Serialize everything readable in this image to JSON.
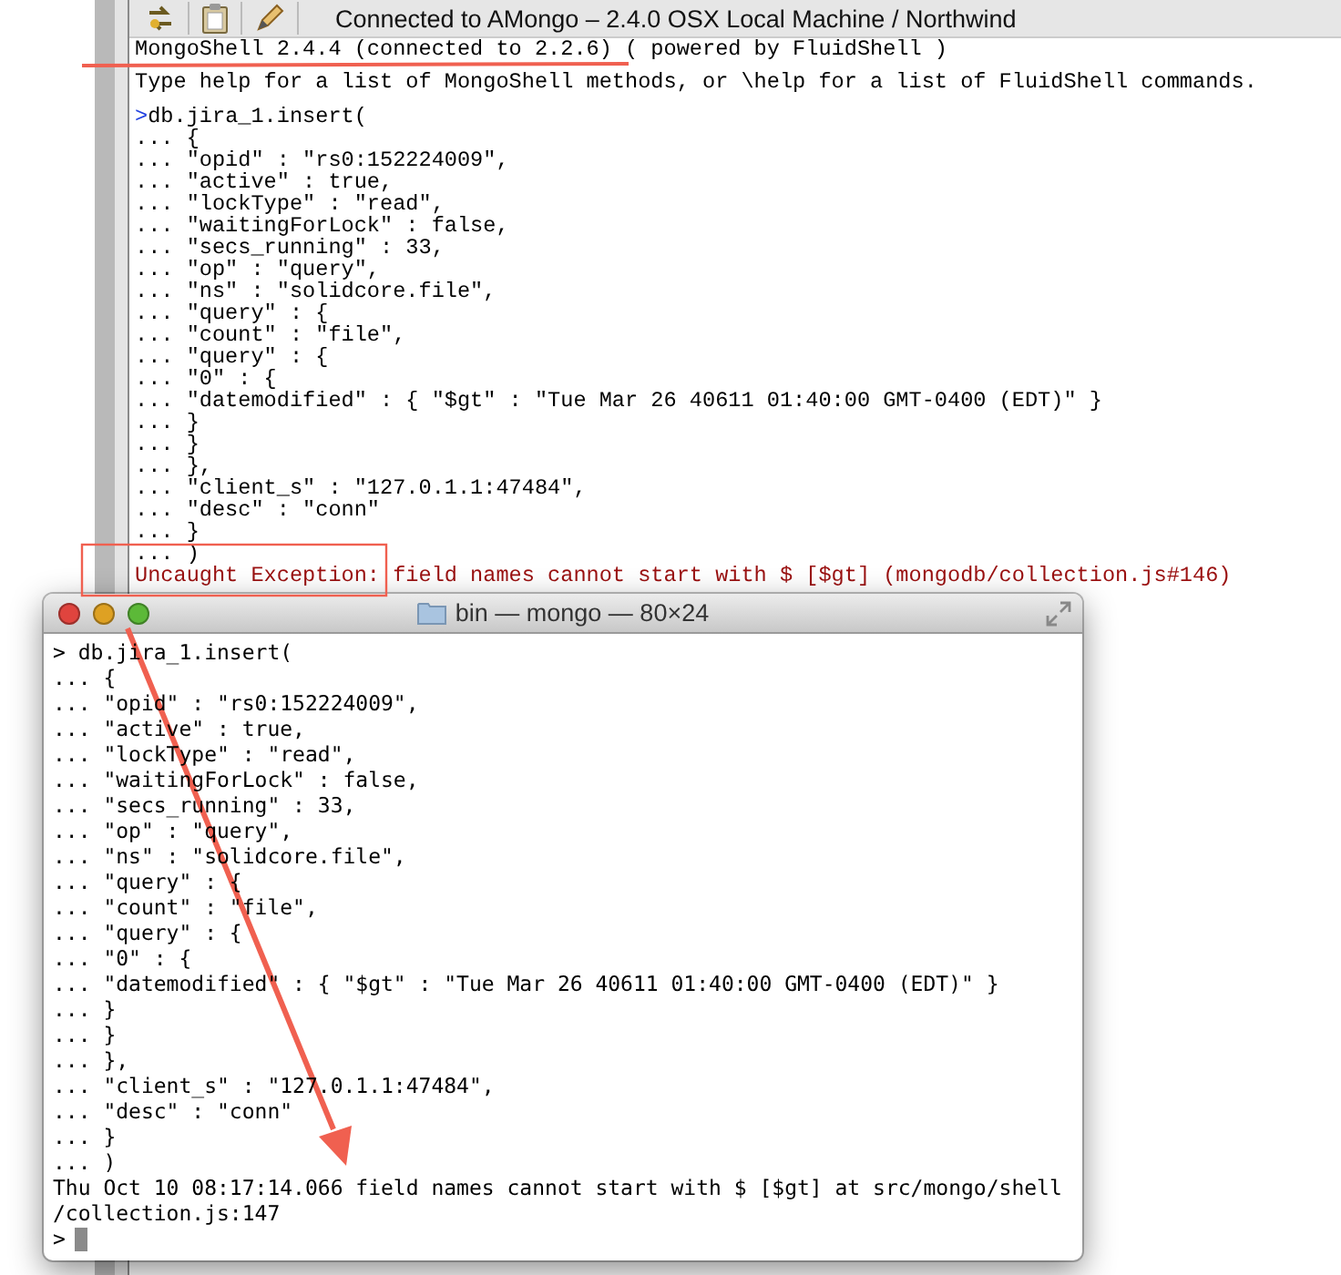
{
  "toolbar": {
    "title": "Connected to AMongo – 2.4.0 OSX Local Machine / Northwind"
  },
  "shell": {
    "lines": [
      {
        "kind": "output",
        "text": "MongoShell 2.4.4 (connected to 2.2.6) ( powered by FluidShell )"
      },
      {
        "kind": "output",
        "text": "Type help for a list of MongoShell methods, or \\help for a list of FluidShell commands."
      },
      {
        "kind": "input",
        "prompt": ">",
        "text": "db.jira_1.insert("
      },
      {
        "kind": "plain",
        "text": "... {"
      },
      {
        "kind": "plain",
        "text": "... \"opid\" : \"rs0:152224009\","
      },
      {
        "kind": "plain",
        "text": "... \"active\" : true,"
      },
      {
        "kind": "plain",
        "text": "... \"lockType\" : \"read\","
      },
      {
        "kind": "plain",
        "text": "... \"waitingForLock\" : false,"
      },
      {
        "kind": "plain",
        "text": "... \"secs_running\" : 33,"
      },
      {
        "kind": "plain",
        "text": "... \"op\" : \"query\","
      },
      {
        "kind": "plain",
        "text": "... \"ns\" : \"solidcore.file\","
      },
      {
        "kind": "plain",
        "text": "... \"query\" : {"
      },
      {
        "kind": "plain",
        "text": "... \"count\" : \"file\","
      },
      {
        "kind": "plain",
        "text": "... \"query\" : {"
      },
      {
        "kind": "plain",
        "text": "... \"0\" : {"
      },
      {
        "kind": "plain",
        "text": "... \"datemodified\" : { \"$gt\" : \"Tue Mar 26 40611 01:40:00 GMT-0400 (EDT)\" }"
      },
      {
        "kind": "plain",
        "text": "... }"
      },
      {
        "kind": "plain",
        "text": "... }"
      },
      {
        "kind": "plain",
        "text": "... },"
      },
      {
        "kind": "plain",
        "text": "... \"client_s\" : \"127.0.1.1:47484\","
      },
      {
        "kind": "plain",
        "text": "... \"desc\" : \"conn\""
      },
      {
        "kind": "plain",
        "text": "... }"
      },
      {
        "kind": "plain",
        "text": "... )"
      },
      {
        "kind": "error",
        "text": "Uncaught Exception: field names cannot start with $ [$gt] (mongodb/collection.js#146)"
      }
    ]
  },
  "terminal": {
    "title": "bin — mongo — 80×24",
    "cursor": true,
    "lines": [
      "> db.jira_1.insert(",
      "... {",
      "... \"opid\" : \"rs0:152224009\",",
      "... \"active\" : true,",
      "... \"lockType\" : \"read\",",
      "... \"waitingForLock\" : false,",
      "... \"secs_running\" : 33,",
      "... \"op\" : \"query\",",
      "... \"ns\" : \"solidcore.file\",",
      "... \"query\" : {",
      "... \"count\" : \"file\",",
      "... \"query\" : {",
      "... \"0\" : {",
      "... \"datemodified\" : { \"$gt\" : \"Tue Mar 26 40611 01:40:00 GMT-0400 (EDT)\" }",
      "... }",
      "... }",
      "... },",
      "... \"client_s\" : \"127.0.1.1:47484\",",
      "... \"desc\" : \"conn\"",
      "... }",
      "... )",
      "Thu Oct 10 08:17:14.066 field names cannot start with $ [$gt] at src/mongo/shell",
      "/collection.js:147",
      ">"
    ]
  }
}
